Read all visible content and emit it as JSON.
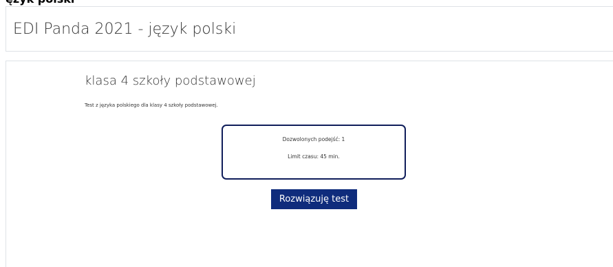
{
  "top_fragment": "ęzyk polski ",
  "page": {
    "title": "EDI Panda 2021 - język polski"
  },
  "quiz": {
    "name": "klasa 4 szkoły podstawowej",
    "intro": "Test z języka polskiego dla klasy 4 szkoły podstawowej.",
    "attempts_allowed": "Dozwolonych podejść: 1",
    "time_limit": "Limit czasu: 45 min.",
    "start_button_label": "Rozwiązuję test"
  },
  "colors": {
    "button_bg": "#0f2c7c",
    "info_border": "#0f1d5a"
  }
}
